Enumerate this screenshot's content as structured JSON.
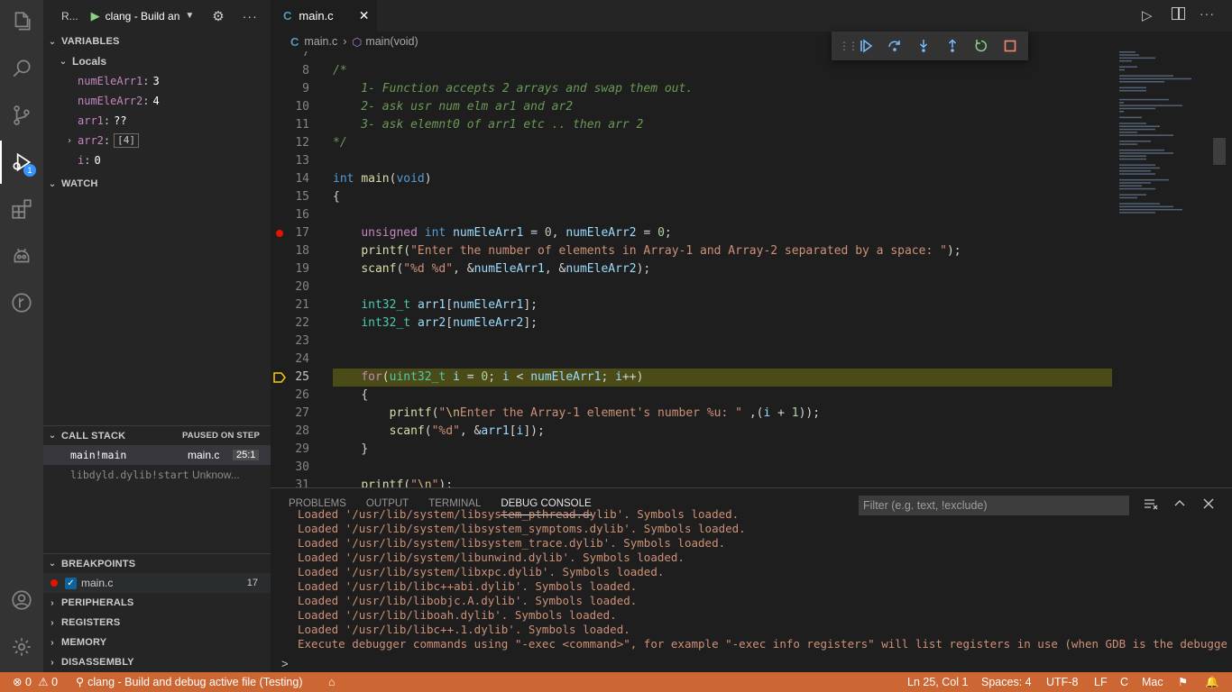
{
  "sidebar": {
    "header_label": "R...",
    "launch_config": "clang - Build an",
    "variables_title": "VARIABLES",
    "locals_title": "Locals",
    "variables": [
      {
        "name": "numEleArr1",
        "value": "3"
      },
      {
        "name": "numEleArr2",
        "value": "4"
      },
      {
        "name": "arr1",
        "value": "??"
      },
      {
        "name": "arr2",
        "value": "[4]"
      },
      {
        "name": "i",
        "value": "0"
      }
    ],
    "watch_title": "WATCH",
    "callstack_title": "CALL STACK",
    "callstack_status": "PAUSED ON STEP",
    "frames": [
      {
        "name": "main!main",
        "file": "main.c",
        "pos": "25:1"
      },
      {
        "name": "libdyld.dylib!start",
        "file": "Unknow..."
      }
    ],
    "breakpoints_title": "BREAKPOINTS",
    "breakpoint": {
      "file": "main.c",
      "line": "17"
    },
    "peripherals_title": "PERIPHERALS",
    "registers_title": "REGISTERS",
    "memory_title": "MEMORY",
    "disassembly_title": "DISASSEMBLY"
  },
  "activity": {
    "debug_badge": "1"
  },
  "tabs": [
    {
      "label": "main.c"
    }
  ],
  "breadcrumb": {
    "file": "main.c",
    "symbol": "main(void)"
  },
  "editor": {
    "lines": [
      {
        "n": "8",
        "html": "<span class='cm'>/*</span>"
      },
      {
        "n": "9",
        "html": "<span class='cm'>    1- Function accepts 2 arrays and swap them out.</span>"
      },
      {
        "n": "10",
        "html": "<span class='cm'>    2- ask usr num elm ar1 and ar2</span>"
      },
      {
        "n": "11",
        "html": "<span class='cm'>    3- ask elemnt0 of arr1 etc .. then arr 2</span>"
      },
      {
        "n": "12",
        "html": "<span class='cm'>*/</span>"
      },
      {
        "n": "13",
        "html": ""
      },
      {
        "n": "14",
        "html": "<span class='kw'>int</span> <span class='fn'>main</span><span class='pl'>(</span><span class='kw'>void</span><span class='pl'>)</span>"
      },
      {
        "n": "15",
        "html": "<span class='pl'>{</span>"
      },
      {
        "n": "16",
        "html": ""
      },
      {
        "n": "17",
        "html": "    <span class='kw2'>unsigned</span> <span class='kw'>int</span> <span class='va'>numEleArr1</span> <span class='pl'>=</span> <span class='nu'>0</span><span class='pl'>,</span> <span class='va'>numEleArr2</span> <span class='pl'>=</span> <span class='nu'>0</span><span class='pl'>;</span>"
      },
      {
        "n": "18",
        "html": "    <span class='fn'>printf</span><span class='pl'>(</span><span class='st'>\"Enter the number of elements in Array-1 and Array-2 separated by a space: \"</span><span class='pl'>);</span>"
      },
      {
        "n": "19",
        "html": "    <span class='fn'>scanf</span><span class='pl'>(</span><span class='st'>\"%d %d\"</span><span class='pl'>, &amp;</span><span class='va'>numEleArr1</span><span class='pl'>, &amp;</span><span class='va'>numEleArr2</span><span class='pl'>);</span>"
      },
      {
        "n": "20",
        "html": ""
      },
      {
        "n": "21",
        "html": "    <span class='ty'>int32_t</span> <span class='va'>arr1</span><span class='pl'>[</span><span class='va'>numEleArr1</span><span class='pl'>];</span>"
      },
      {
        "n": "22",
        "html": "    <span class='ty'>int32_t</span> <span class='va'>arr2</span><span class='pl'>[</span><span class='va'>numEleArr2</span><span class='pl'>];</span>"
      },
      {
        "n": "23",
        "html": ""
      },
      {
        "n": "24",
        "html": ""
      },
      {
        "n": "25",
        "html": "    <span class='kw2'>for</span><span class='pl'>(</span><span class='ty'>uint32_t</span> <span class='va'>i</span> <span class='pl'>=</span> <span class='nu'>0</span><span class='pl'>;</span> <span class='va'>i</span> <span class='pl'>&lt;</span> <span class='va'>numEleArr1</span><span class='pl'>;</span> <span class='va'>i</span><span class='pl'>++)</span>"
      },
      {
        "n": "26",
        "html": "    <span class='pl'>{</span>"
      },
      {
        "n": "27",
        "html": "        <span class='fn'>printf</span><span class='pl'>(</span><span class='st'>\"</span><span class='es'>\\n</span><span class='st'>Enter the Array-1 element's number %u: \"</span> <span class='pl'>,(</span><span class='va'>i</span> <span class='pl'>+</span> <span class='nu'>1</span><span class='pl'>));</span>"
      },
      {
        "n": "28",
        "html": "        <span class='fn'>scanf</span><span class='pl'>(</span><span class='st'>\"%d\"</span><span class='pl'>, &amp;</span><span class='va'>arr1</span><span class='pl'>[</span><span class='va'>i</span><span class='pl'>]);</span>"
      },
      {
        "n": "29",
        "html": "    <span class='pl'>}</span>"
      },
      {
        "n": "30",
        "html": ""
      },
      {
        "n": "31",
        "html": "    <span class='fn'>printf</span><span class='pl'>(</span><span class='st'>\"</span><span class='es'>\\n</span><span class='st'>\"</span><span class='pl'>);</span>"
      }
    ]
  },
  "panel": {
    "tabs": [
      "PROBLEMS",
      "OUTPUT",
      "TERMINAL",
      "DEBUG CONSOLE"
    ],
    "filter_placeholder": "Filter (e.g. text, !exclude)",
    "console": [
      "Loaded '/usr/lib/system/libsystem_pthread.dylib'. Symbols loaded.",
      "Loaded '/usr/lib/system/libsystem_symptoms.dylib'. Symbols loaded.",
      "Loaded '/usr/lib/system/libsystem_trace.dylib'. Symbols loaded.",
      "Loaded '/usr/lib/system/libunwind.dylib'. Symbols loaded.",
      "Loaded '/usr/lib/system/libxpc.dylib'. Symbols loaded.",
      "Loaded '/usr/lib/libc++abi.dylib'. Symbols loaded.",
      "Loaded '/usr/lib/libobjc.A.dylib'. Symbols loaded.",
      "Loaded '/usr/lib/liboah.dylib'. Symbols loaded.",
      "Loaded '/usr/lib/libc++.1.dylib'. Symbols loaded.",
      "Execute debugger commands using \"-exec <command>\", for example \"-exec info registers\" will list registers in use (when GDB is the debugger)"
    ],
    "prompt": ">"
  },
  "status": {
    "errors": "0",
    "warnings": "0",
    "debug_config": "clang - Build and debug active file (Testing)",
    "position": "Ln 25, Col 1",
    "spaces": "Spaces: 4",
    "encoding": "UTF-8",
    "eol": "LF",
    "language": "C",
    "platform": "Mac"
  },
  "colors": {
    "statusbar": "#cc6633",
    "current_line": "#4b4b18",
    "breakpoint": "#e51400",
    "badge": "#3794ff"
  }
}
